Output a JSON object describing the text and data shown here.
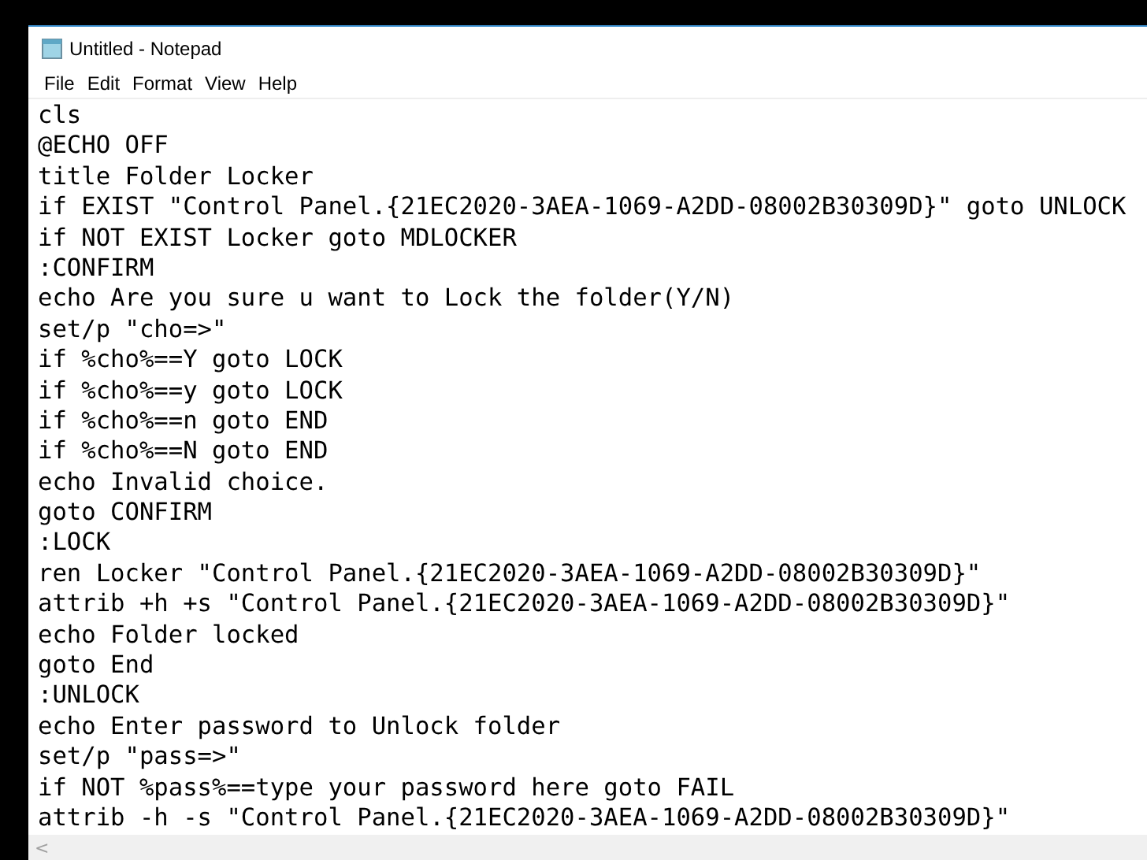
{
  "window": {
    "title": "Untitled - Notepad"
  },
  "menu": [
    "File",
    "Edit",
    "Format",
    "View",
    "Help"
  ],
  "editor": {
    "lines": [
      "cls",
      "@ECHO OFF",
      "title Folder Locker",
      "if EXIST \"Control Panel.{21EC2020-3AEA-1069-A2DD-08002B30309D}\" goto UNLOCK",
      "if NOT EXIST Locker goto MDLOCKER",
      ":CONFIRM",
      "echo Are you sure u want to Lock the folder(Y/N)",
      "set/p \"cho=>\"",
      "if %cho%==Y goto LOCK",
      "if %cho%==y goto LOCK",
      "if %cho%==n goto END",
      "if %cho%==N goto END",
      "echo Invalid choice.",
      "goto CONFIRM",
      ":LOCK",
      "ren Locker \"Control Panel.{21EC2020-3AEA-1069-A2DD-08002B30309D}\"",
      "attrib +h +s \"Control Panel.{21EC2020-3AEA-1069-A2DD-08002B30309D}\"",
      "echo Folder locked",
      "goto End",
      ":UNLOCK",
      "echo Enter password to Unlock folder",
      "set/p \"pass=>\"",
      "if NOT %pass%==type your password here goto FAIL",
      "attrib -h -s \"Control Panel.{21EC2020-3AEA-1069-A2DD-08002B30309D}\""
    ]
  },
  "scrollbar": {
    "left_arrow": "<"
  }
}
